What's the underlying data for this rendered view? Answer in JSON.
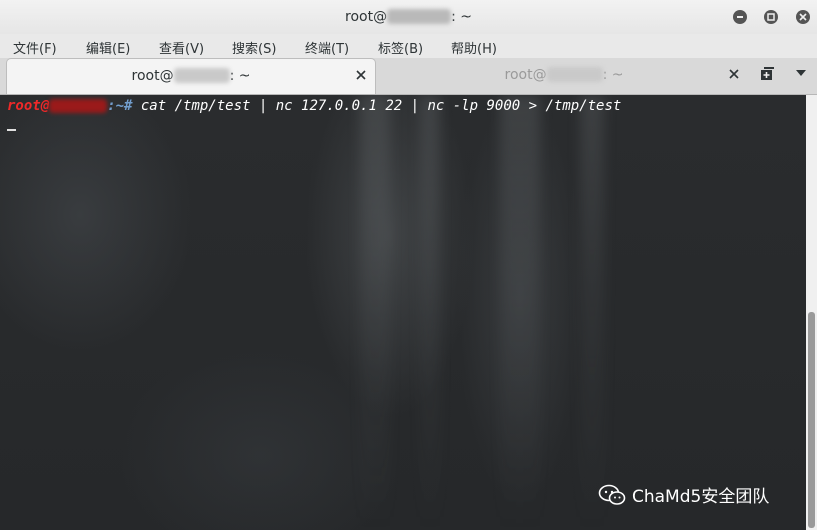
{
  "window": {
    "title_prefix": "root@",
    "title_suffix": ": ~",
    "buttons": [
      "minimize",
      "maximize",
      "close"
    ]
  },
  "menu": {
    "items": [
      "文件(F)",
      "编辑(E)",
      "查看(V)",
      "搜索(S)",
      "终端(T)",
      "标签(B)",
      "帮助(H)"
    ]
  },
  "tabs": [
    {
      "prefix": "root@",
      "suffix": ": ~",
      "active": true
    },
    {
      "prefix": "root@",
      "suffix": ": ~",
      "active": false
    }
  ],
  "terminal": {
    "prompt_user": "root@",
    "prompt_path": ":~#",
    "command": " cat /tmp/test | nc 127.0.0.1 22 | nc -lp 9000 > /tmp/test"
  },
  "watermark": {
    "text": "ChaMd5安全团队"
  },
  "colors": {
    "prompt_user": "#ef2929",
    "prompt_path": "#729fcf",
    "command": "#ffffff"
  }
}
